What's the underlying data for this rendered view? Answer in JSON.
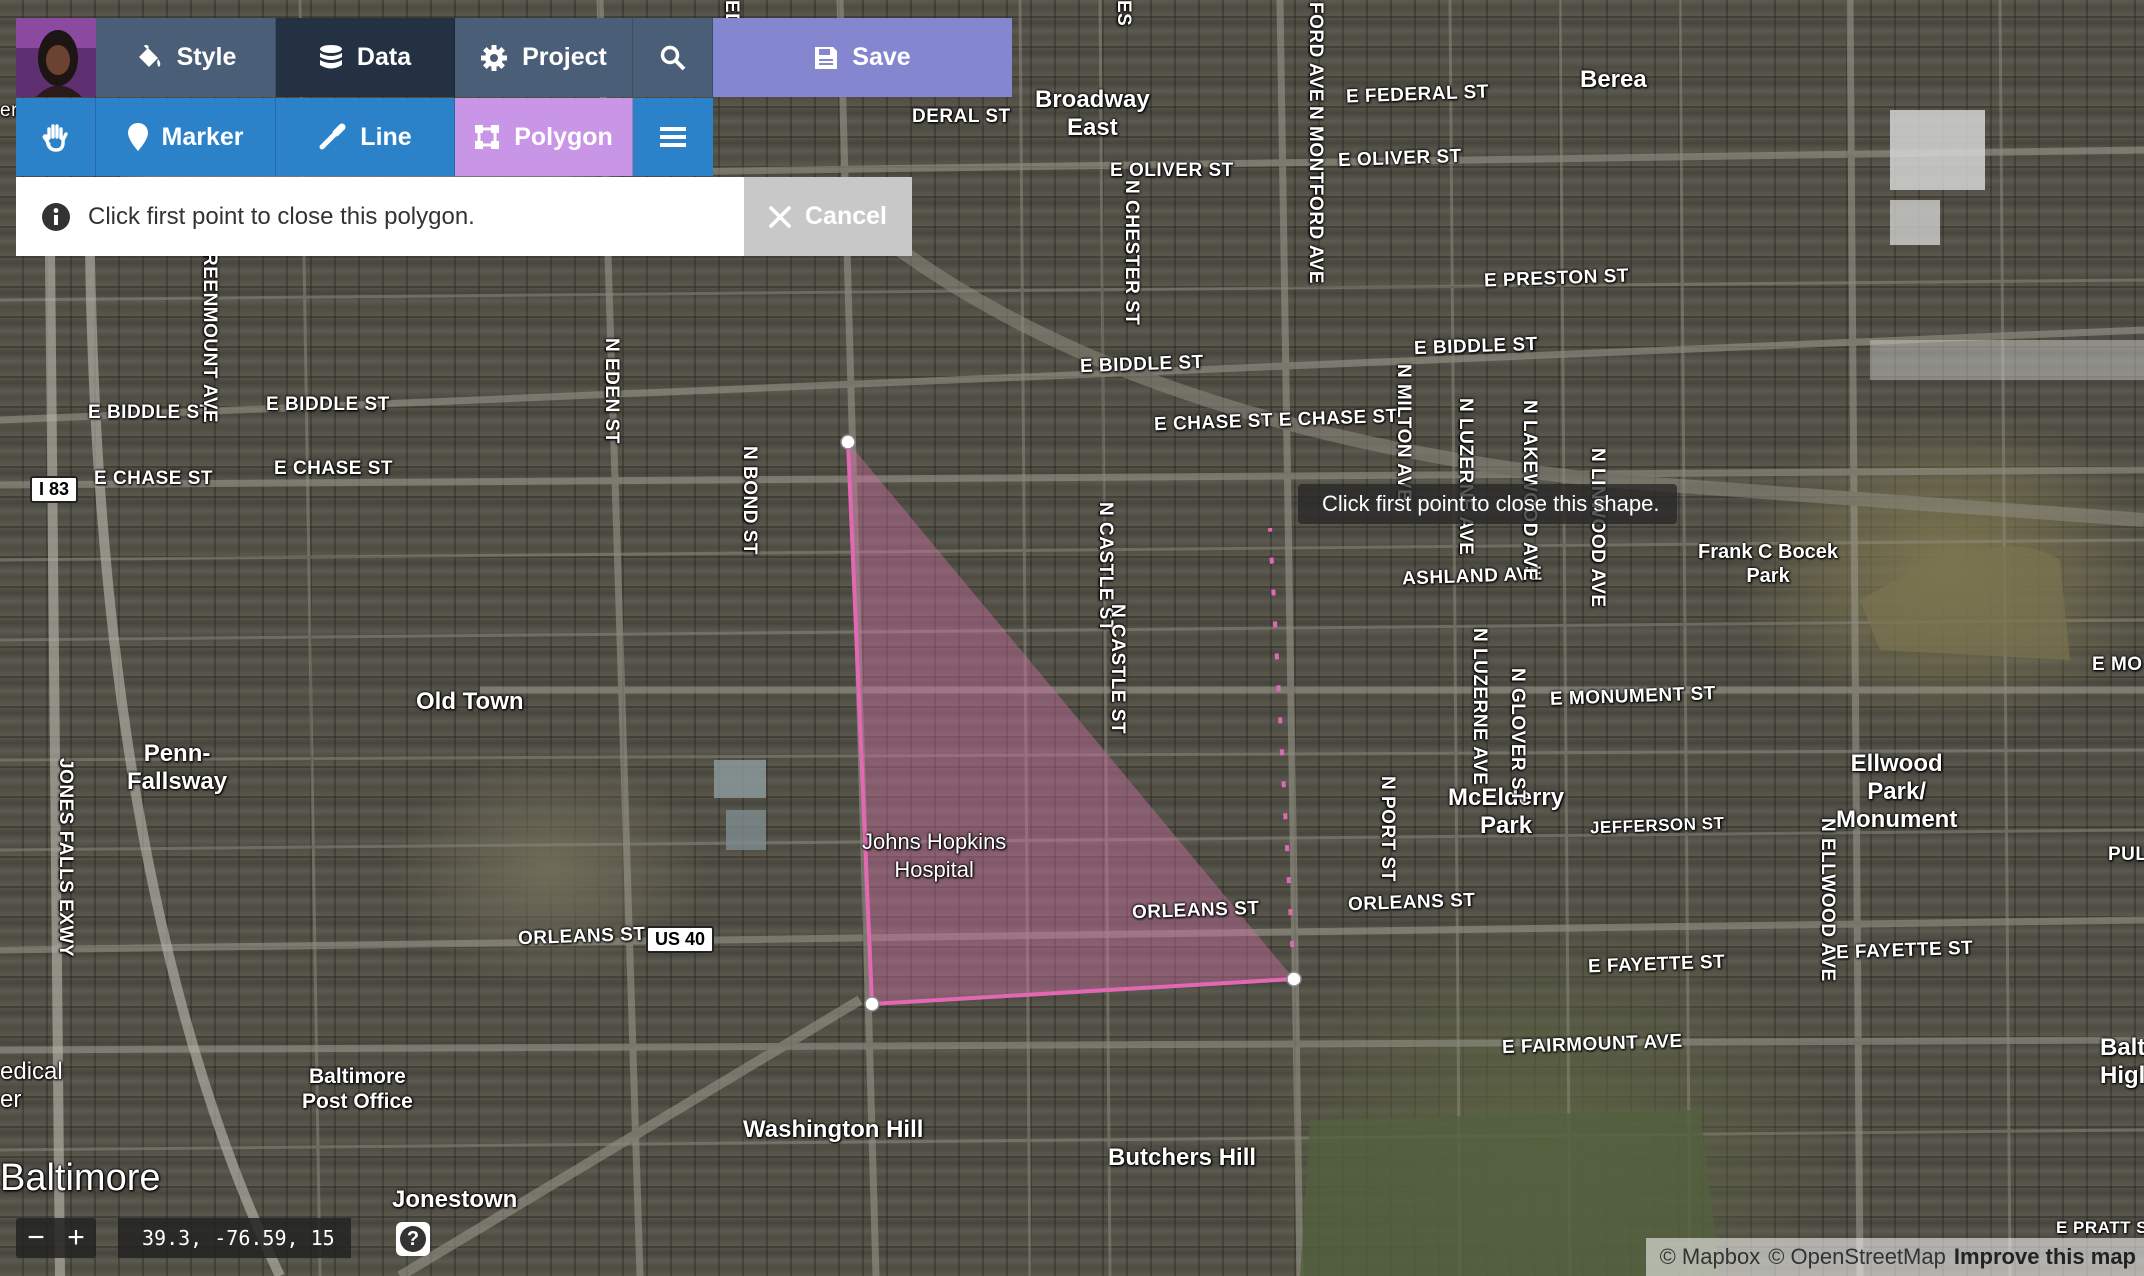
{
  "toolbar": {
    "style_label": "Style",
    "data_label": "Data",
    "project_label": "Project",
    "save_label": "Save",
    "marker_label": "Marker",
    "line_label": "Line",
    "polygon_label": "Polygon",
    "hint_text": "Click first point to close this polygon.",
    "cancel_label": "Cancel"
  },
  "colors": {
    "slate": "#4b5e78",
    "dark": "#233143",
    "blue": "#2c82c9",
    "save_violet": "#8486cf",
    "polygon_active": "#c995e6",
    "polygon_stroke": "#e368b4"
  },
  "icons": [
    "paint-bucket-icon",
    "database-icon",
    "gear-icon",
    "search-icon",
    "save-disk-icon",
    "hand-icon",
    "marker-pin-icon",
    "line-pencil-icon",
    "polygon-icon",
    "menu-icon",
    "info-icon",
    "close-icon",
    "help-icon"
  ],
  "map": {
    "tooltip": "Click first point to close this shape.",
    "places": {
      "berea": "Berea",
      "broadway_east": "Broadway\nEast",
      "old_town": "Old Town",
      "penn_fallsway": "Penn-\nFallsway",
      "jhh": "Johns Hopkins\nHospital",
      "frank_bocek": "Frank C Bocek\nPark",
      "mcelderry": "McElderry\nPark",
      "ellwood": "Ellwood\nPark/\nMonument",
      "baltimore_po": "Baltimore\nPost Office",
      "washington_hill": "Washington Hill",
      "butchers_hill": "Butchers Hill",
      "baltimore": "Baltimore",
      "jonestown": "Jonestown",
      "medical": "edical\ner",
      "balt_high": "Balt\nHigl"
    },
    "streets": {
      "e_federal": "E FEDERAL ST",
      "deral": "DERAL ST",
      "e_oliver_1": "E OLIVER ST",
      "e_oliver_2": "E OLIVER ST",
      "e_preston": "E PRESTON ST",
      "e_biddle_1": "E BIDDLE ST",
      "e_biddle_2": "E BIDDLE ST",
      "e_biddle_3": "E BIDDLE ST",
      "e_biddle_4": "E BIDDLE ST",
      "e_chase_1": "E CHASE ST",
      "e_chase_2": "E CHASE ST",
      "e_chase_3": "E CHASE ST E CHASE ST",
      "ashland": "ASHLAND AVE",
      "e_monument": "E MONUMENT ST",
      "e_mo": "E MO",
      "jefferson": "JEFFERSON ST",
      "orleans_1": "ORLEANS ST",
      "orleans_2": "ORLEANS ST",
      "orleans_3": "ORLEANS ST",
      "e_fayette_1": "E FAYETTE ST",
      "e_fayette_2": "E FAYETTE ST",
      "e_fairmount": "E FAIRMOUNT AVE",
      "e_pratt": "E PRATT S",
      "pul": "PUL",
      "ford": "FORD AVE",
      "n_montford": "N MONTFORD AVE",
      "n_chester": "N CHESTER ST",
      "n_eden": "N EDEN ST",
      "n_bond": "N BOND ST",
      "n_castle_1": "N CASTLE ST",
      "n_castle_2": "N CASTLE ST",
      "n_milton": "N MILTON AVE",
      "n_luzerne_1": "N LUZERNE AVE",
      "n_luzerne_2": "N LUZERNE AVE",
      "n_lakewood": "N LAKEWOOD AVE",
      "n_linwood": "N LINWOOD AVE",
      "n_glover": "N GLOVER ST",
      "n_port": "N PORT ST",
      "n_ellwood": "N ELLWOOD AVE",
      "greenmount": "REENMOUNT AVE",
      "jones_falls": "JONES FALLS EXWY",
      "ed_top": "ED",
      "es_top": "ES"
    },
    "shields": {
      "i83": "I 83",
      "us40": "US 40"
    }
  },
  "status": {
    "zoom_out": "−",
    "zoom_in": "+",
    "coords": "39.3, -76.59, 15",
    "help": "?",
    "attribution_mapbox": "© Mapbox",
    "attribution_osm": "© OpenStreetMap",
    "attribution_improve": "Improve this map",
    "edge_left": "er"
  }
}
